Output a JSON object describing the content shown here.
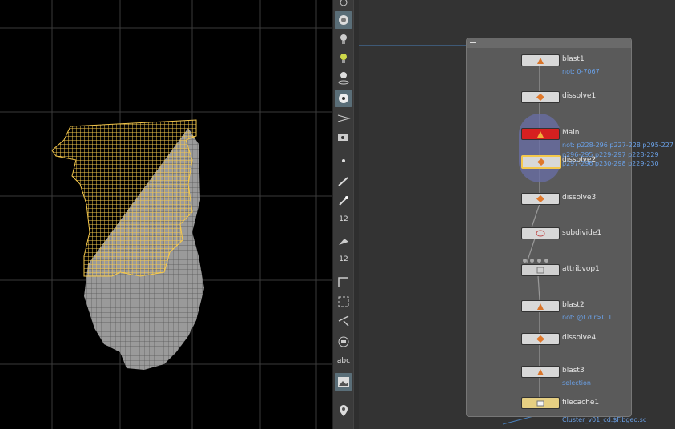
{
  "viewport": {
    "selection_color": "#f5c84c",
    "mesh_color": "#9a9a9a"
  },
  "toolbar": {
    "tools": [
      "light-icon",
      "camera-icon",
      "bulb-icon",
      "point-light-icon",
      "spot-light-icon",
      "paint-icon",
      "env-light-icon",
      "camera-add-icon",
      "point-icon",
      "brush-icon",
      "pin-icon",
      "number-12-icon",
      "sweep-icon",
      "measure-12-icon",
      "corner-icon",
      "snap-grid-icon",
      "angle-icon",
      "shape-icon",
      "abc-text",
      "image-icon",
      "marker-icon"
    ],
    "abc_label": "abc",
    "label_12a": "12",
    "label_12b": "12"
  },
  "network": {
    "nodes": [
      {
        "name": "blast1",
        "sub": "not: 0-7067"
      },
      {
        "name": "dissolve1",
        "sub": ""
      },
      {
        "name": "Main",
        "sub": "not: p228-296 p227-228 p295-227"
      },
      {
        "name": "dissolve2",
        "sub": "p296-295 p229-297 p228-229 p297-296 p230-298 p229-230 p298-297..."
      },
      {
        "name": "dissolve3",
        "sub": ""
      },
      {
        "name": "subdivide1",
        "sub": ""
      },
      {
        "name": "attribvop1",
        "sub": ""
      },
      {
        "name": "blast2",
        "sub": "not: @Cd.r>0.1"
      },
      {
        "name": "dissolve4",
        "sub": ""
      },
      {
        "name": "blast3",
        "sub": "selection"
      },
      {
        "name": "filecache1",
        "sub": "Cluster_v01_cd.$F.bgeo.sc"
      }
    ],
    "colors": {
      "main_node": "#d62020",
      "dissolve2_highlight": "#f5c84c",
      "wire": "#4a7fb8",
      "label_blue": "#6aa0e6"
    }
  }
}
